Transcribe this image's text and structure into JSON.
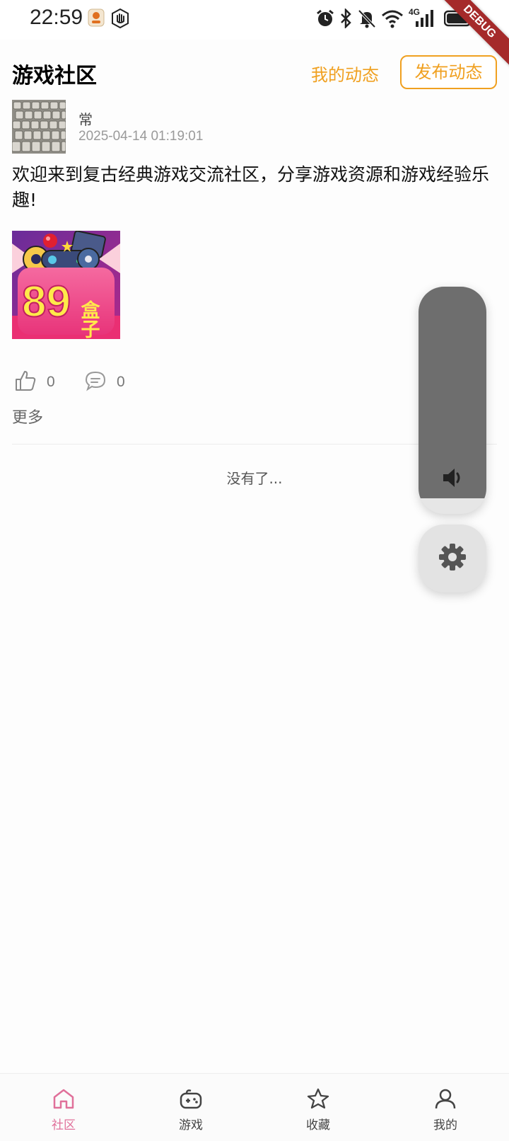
{
  "status_bar": {
    "time": "22:59",
    "icons": [
      "app-notification-icon",
      "hand-icon",
      "alarm-icon",
      "bluetooth-icon",
      "bell-off-icon",
      "wifi-icon",
      "signal-4g-icon",
      "battery-icon"
    ],
    "network_label": "4G",
    "debug_banner": "DEBUG"
  },
  "header": {
    "title": "游戏社区",
    "my_posts_label": "我的动态",
    "publish_label": "发布动态",
    "accent_color": "#f0a020"
  },
  "post": {
    "author": "常",
    "timestamp": "2025-04-14 01:19:01",
    "content": "欢迎来到复古经典游戏交流社区，分享游戏资源和游戏经验乐趣!",
    "image_text_number": "89",
    "image_text_chars": "盒子",
    "likes": "0",
    "comments": "0",
    "more_label": "更多"
  },
  "feed_end_text": "没有了...",
  "volume_overlay": {
    "level": 0.93,
    "icons": [
      "speaker-icon",
      "gear-icon"
    ]
  },
  "bottom_nav": {
    "active_color": "#e0709a",
    "items": [
      {
        "label": "社区",
        "icon": "home-icon",
        "active": true
      },
      {
        "label": "游戏",
        "icon": "gamepad-icon",
        "active": false
      },
      {
        "label": "收藏",
        "icon": "star-icon",
        "active": false
      },
      {
        "label": "我的",
        "icon": "user-icon",
        "active": false
      }
    ]
  }
}
